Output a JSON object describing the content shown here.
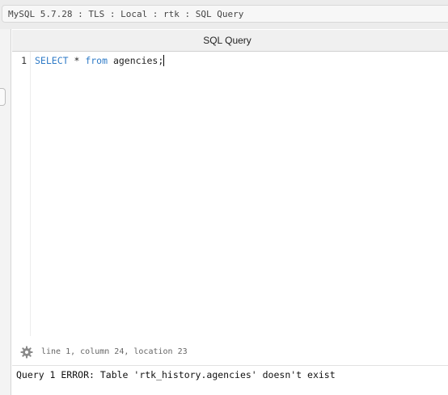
{
  "window": {
    "connection_path": "MySQL 5.7.28 : TLS : Local : rtk : SQL Query"
  },
  "tab": {
    "label": "SQL Query"
  },
  "editor": {
    "line_numbers": [
      "1"
    ],
    "line1": {
      "keyword1": "SELECT",
      "middle": " * ",
      "keyword2": "from",
      "rest": " agencies;"
    }
  },
  "status": {
    "position_text": "line 1, column 24, location 23",
    "icon": "gear-icon"
  },
  "result": {
    "message": "Query 1 ERROR: Table 'rtk_history.agencies' doesn't exist"
  },
  "colors": {
    "keyword": "#2f7bc7",
    "background": "#ffffff",
    "titlebar": "#ececec"
  }
}
